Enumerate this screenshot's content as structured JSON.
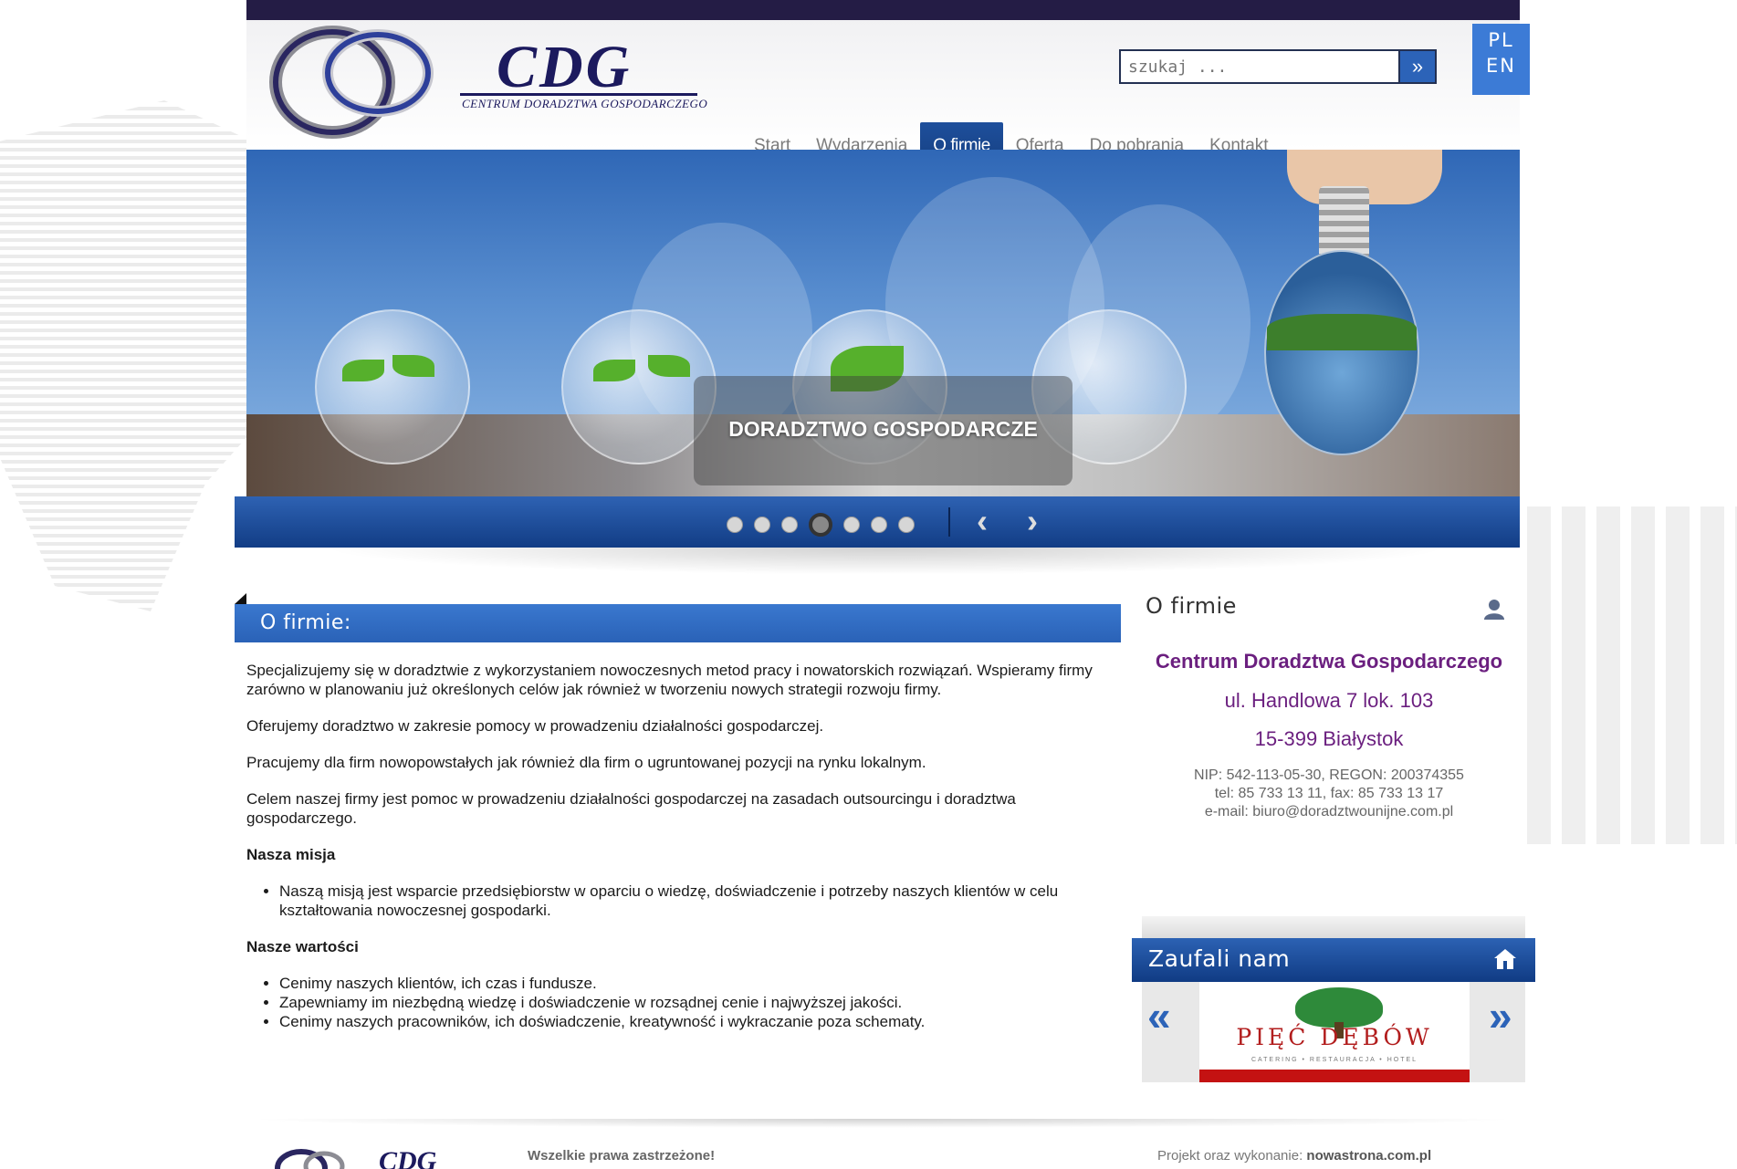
{
  "brand": {
    "title": "CDG",
    "subtitle": "CENTRUM DORADZTWA GOSPODARCZEGO"
  },
  "search": {
    "placeholder": "szukaj ...",
    "button_icon": "double-chevron-right-icon"
  },
  "languages": [
    "PL",
    "EN"
  ],
  "nav": {
    "items": [
      "Start",
      "Wydarzenia",
      "O firmie",
      "Oferta",
      "Do pobrania",
      "Kontakt"
    ],
    "active": "O firmie"
  },
  "slider": {
    "caption": "DORADZTWO GOSPODARCZE",
    "slide_count": 7,
    "active_slide": 3,
    "prev_icon": "chevron-left-icon",
    "next_icon": "chevron-right-icon"
  },
  "main": {
    "heading": "O firmie:",
    "paragraphs": [
      "Specjalizujemy się w doradztwie z wykorzystaniem nowoczesnych metod pracy i nowatorskich rozwiązań. Wspieramy firmy zarówno w planowaniu już określonych celów jak również w tworzeniu nowych strategii rozwoju firmy.",
      "Oferujemy doradztwo w zakresie pomocy w prowadzeniu działalności gospodarczej.",
      "Pracujemy dla firm nowopowstałych jak również dla firm o ugruntowanej pozycji na rynku lokalnym.",
      "Celem naszej firmy jest pomoc w prowadzeniu działalności gospodarczej na zasadach outsourcingu i doradztwa gospodarczego."
    ],
    "mission_title": "Nasza misja",
    "mission_items": [
      "Naszą misją jest wsparcie przedsiębiorstw w oparciu o wiedzę, doświadczenie i potrzeby naszych klientów w celu kształtowania nowoczesnej gospodarki."
    ],
    "values_title": "Nasze wartości",
    "values_items": [
      "Cenimy naszych klientów, ich czas i fundusze.",
      "Zapewniamy im niezbędną wiedzę i doświadczenie w rozsądnej cenie i najwyższej jakości.",
      "Cenimy naszych pracowników, ich doświadczenie, kreatywność i wykraczanie poza schematy."
    ]
  },
  "sidebar": {
    "title": "O firmie",
    "company": "Centrum Doradztwa Gospodarczego",
    "address_line1": "ul. Handlowa 7 lok. 103",
    "address_line2": "15-399 Białystok",
    "nip_regon": "NIP: 542-113-05-30, REGON: 200374355",
    "phone": "tel: 85 733 13 11, fax: 85 733 13 17",
    "email": "e-mail: biuro@doradztwounijne.com.pl",
    "user_icon": "user-icon"
  },
  "trusted": {
    "title": "Zaufali nam",
    "icon": "house-icon",
    "partner_name": "PIĘĆ DĘBÓW",
    "partner_sub": "CATERING • RESTAURACJA • HOTEL"
  },
  "footer": {
    "rights": "Wszelkie prawa zastrzeżone!",
    "credit_label": "Projekt oraz wykonanie:",
    "credit_name": "nowastrona.com.pl"
  },
  "colors": {
    "nav_dark": "#241c45",
    "accent_blue": "#2c63b8",
    "company_purple": "#6b1f7f"
  }
}
